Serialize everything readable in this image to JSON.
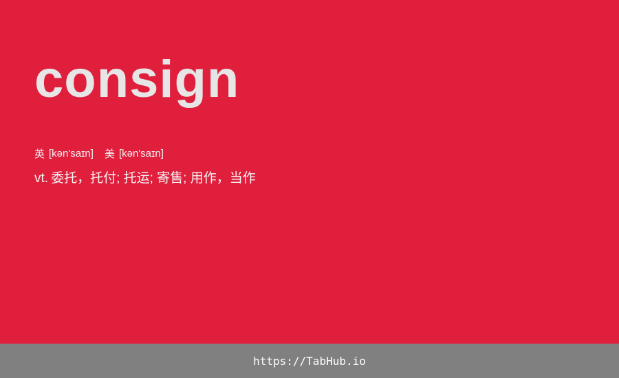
{
  "word": "consign",
  "phonetics": [
    {
      "region": "英",
      "ipa": "[kən'saɪn]"
    },
    {
      "region": "美",
      "ipa": "[kən'saɪn]"
    }
  ],
  "definition": {
    "pos": "vt.",
    "meaning": "委托，托付; 托运; 寄售; 用作，当作"
  },
  "footer": {
    "link_text": "https://TabHub.io"
  },
  "colors": {
    "background": "#e01f3d",
    "word": "#e6e6e6",
    "footer_bar": "#808080",
    "footer_text": "#ffffff"
  }
}
